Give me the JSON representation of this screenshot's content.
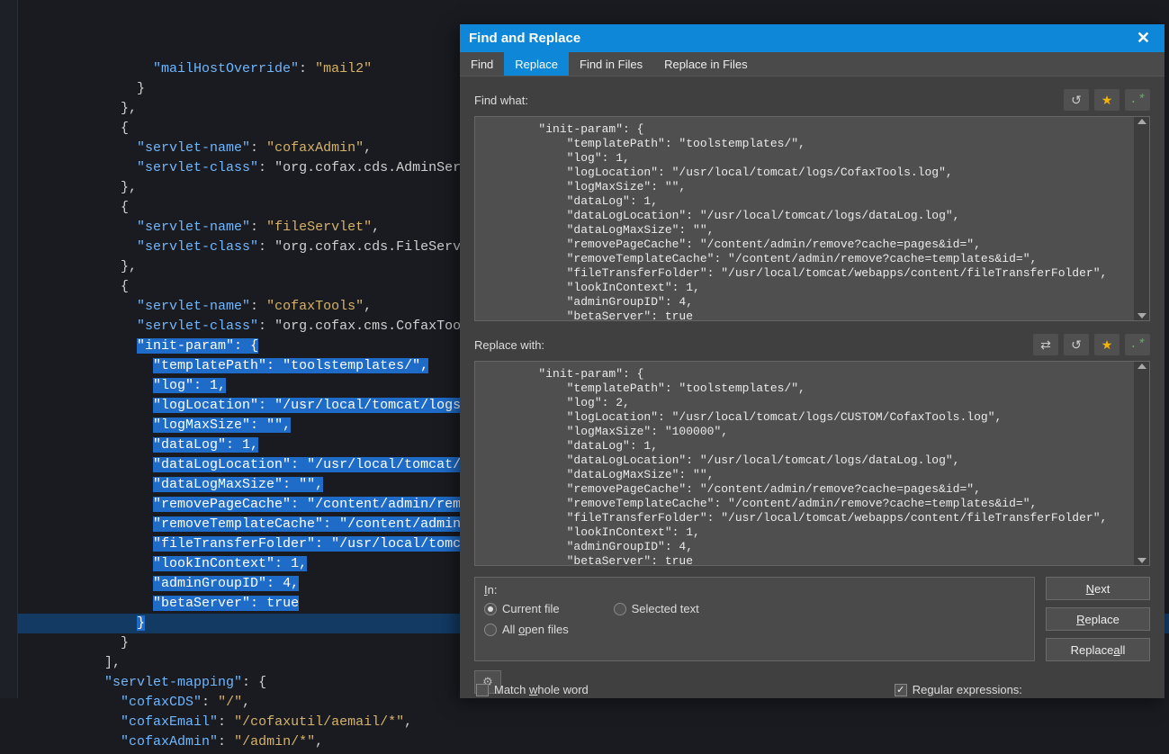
{
  "dialog": {
    "title": "Find and Replace",
    "tabs": [
      "Find",
      "Replace",
      "Find in Files",
      "Replace in Files"
    ],
    "active_tab": "Replace",
    "find_label": "Find what:",
    "replace_label": "Replace with:",
    "find_text": "\"init-param\": {\n    \"templatePath\": \"toolstemplates/\",\n    \"log\": 1,\n    \"logLocation\": \"/usr/local/tomcat/logs/CofaxTools.log\",\n    \"logMaxSize\": \"\",\n    \"dataLog\": 1,\n    \"dataLogLocation\": \"/usr/local/tomcat/logs/dataLog.log\",\n    \"dataLogMaxSize\": \"\",\n    \"removePageCache\": \"/content/admin/remove?cache=pages&id=\",\n    \"removeTemplateCache\": \"/content/admin/remove?cache=templates&id=\",\n    \"fileTransferFolder\": \"/usr/local/tomcat/webapps/content/fileTransferFolder\",\n    \"lookInContext\": 1,\n    \"adminGroupID\": 4,\n    \"betaServer\": true",
    "replace_text": "\"init-param\": {\n    \"templatePath\": \"toolstemplates/\",\n    \"log\": 2,\n    \"logLocation\": \"/usr/local/tomcat/logs/CUSTOM/CofaxTools.log\",\n    \"logMaxSize\": \"100000\",\n    \"dataLog\": 1,\n    \"dataLogLocation\": \"/usr/local/tomcat/logs/dataLog.log\",\n    \"dataLogMaxSize\": \"\",\n    \"removePageCache\": \"/content/admin/remove?cache=pages&id=\",\n    \"removeTemplateCache\": \"/content/admin/remove?cache=templates&id=\",\n    \"fileTransferFolder\": \"/usr/local/tomcat/webapps/content/fileTransferFolder\",\n    \"lookInContext\": 1,\n    \"adminGroupID\": 4,\n    \"betaServer\": true",
    "in_label": "In:",
    "radio_current": "Current file",
    "radio_selected": "Selected text",
    "radio_allopen": "All open files",
    "btn_next": "Next",
    "btn_replace": "Replace",
    "btn_replaceall": "Replace all",
    "chk_whole": "Match whole word",
    "chk_regex": "Regular expressions:"
  },
  "editor": {
    "lines": [
      {
        "i": 0,
        "t": "        \"mailHostOverride\": \"mail2\""
      },
      {
        "i": 1,
        "t": "      }"
      },
      {
        "i": 2,
        "t": "    },"
      },
      {
        "i": 3,
        "t": "    {"
      },
      {
        "i": 4,
        "t": "      \"servlet-name\": \"cofaxAdmin\","
      },
      {
        "i": 5,
        "t": "      \"servlet-class\": \"org.cofax.cds.AdminServl"
      },
      {
        "i": 6,
        "t": "    },"
      },
      {
        "i": 7,
        "t": "    {"
      },
      {
        "i": 8,
        "t": "      \"servlet-name\": \"fileServlet\","
      },
      {
        "i": 9,
        "t": "      \"servlet-class\": \"org.cofax.cds.FileServle"
      },
      {
        "i": 10,
        "t": "    },"
      },
      {
        "i": 11,
        "t": "    {"
      },
      {
        "i": 12,
        "t": "      \"servlet-name\": \"cofaxTools\","
      },
      {
        "i": 13,
        "t": "      \"servlet-class\": \"org.cofax.cms.CofaxTools"
      },
      {
        "i": 14,
        "t": "      \"init-param\": {",
        "sel": true
      },
      {
        "i": 15,
        "t": "        \"templatePath\": \"toolstemplates/\",",
        "sel": true
      },
      {
        "i": 16,
        "t": "        \"log\": 1,",
        "sel": true
      },
      {
        "i": 17,
        "t": "        \"logLocation\": \"/usr/local/tomcat/logs/C",
        "sel": true
      },
      {
        "i": 18,
        "t": "        \"logMaxSize\": \"\",",
        "sel": true
      },
      {
        "i": 19,
        "t": "        \"dataLog\": 1,",
        "sel": true
      },
      {
        "i": 20,
        "t": "        \"dataLogLocation\": \"/usr/local/tomcat/lo",
        "sel": true
      },
      {
        "i": 21,
        "t": "        \"dataLogMaxSize\": \"\",",
        "sel": true
      },
      {
        "i": 22,
        "t": "        \"removePageCache\": \"/content/admin/remov",
        "sel": true
      },
      {
        "i": 23,
        "t": "        \"removeTemplateCache\": \"/content/admin/r",
        "sel": true
      },
      {
        "i": 24,
        "t": "        \"fileTransferFolder\": \"/usr/local/tomcat",
        "sel": true
      },
      {
        "i": 25,
        "t": "        \"lookInContext\": 1,",
        "sel": true
      },
      {
        "i": 26,
        "t": "        \"adminGroupID\": 4,",
        "sel": true
      },
      {
        "i": 27,
        "t": "        \"betaServer\": true",
        "sel": true
      },
      {
        "i": 28,
        "t": "      }",
        "sel": true,
        "curr": true
      },
      {
        "i": 29,
        "t": "    }"
      },
      {
        "i": 30,
        "t": "  ],"
      },
      {
        "i": 31,
        "t": "  \"servlet-mapping\": {"
      },
      {
        "i": 32,
        "t": "    \"cofaxCDS\": \"/\","
      },
      {
        "i": 33,
        "t": "    \"cofaxEmail\": \"/cofaxutil/aemail/*\","
      },
      {
        "i": 34,
        "t": "    \"cofaxAdmin\": \"/admin/*\","
      }
    ]
  }
}
